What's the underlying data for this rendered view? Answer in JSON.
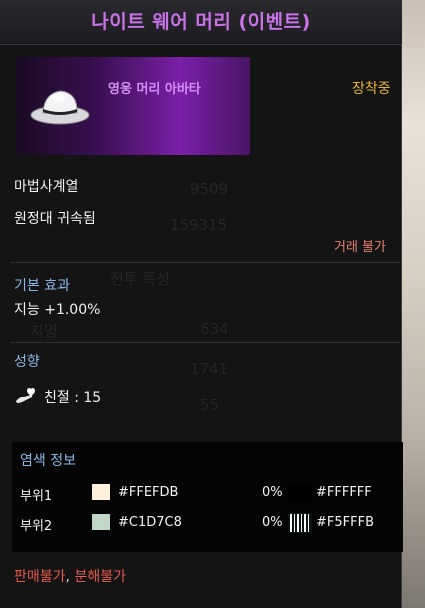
{
  "item": {
    "title": "나이트 웨어 머리 (이벤트)",
    "banner_label": "영웅 머리 아바타",
    "status": "장착중",
    "class_line": "마법사계열",
    "bind_line": "원정대 귀속됨",
    "trade": "거래 불가"
  },
  "basic_effect": {
    "header": "기본 효과",
    "line": "지능 +1.00%"
  },
  "tendency": {
    "header": "성향",
    "icon": "heart-hand-icon",
    "line": "친절 : 15"
  },
  "dye": {
    "header": "염색 정보",
    "rows": [
      {
        "part": "부위1",
        "color": "#FFEFDB",
        "color_label": "#FFEFDB",
        "percent": "0%",
        "color2": "#000000",
        "color2_label": "#FFFFFF",
        "pattern": false
      },
      {
        "part": "부위2",
        "color": "#C1D7C8",
        "color_label": "#C1D7C8",
        "percent": "0%",
        "color2": "#F5FFFB",
        "color2_label": "#F5FFFB",
        "pattern": true
      }
    ]
  },
  "footer": {
    "no_sell": "판매불가",
    "separator": ", ",
    "no_disassemble": "분해불가"
  },
  "colors": {
    "title": "#C873E8",
    "equipped": "#E6B533",
    "section_header": "#8AB8E6",
    "warning": "#E45A4A"
  }
}
